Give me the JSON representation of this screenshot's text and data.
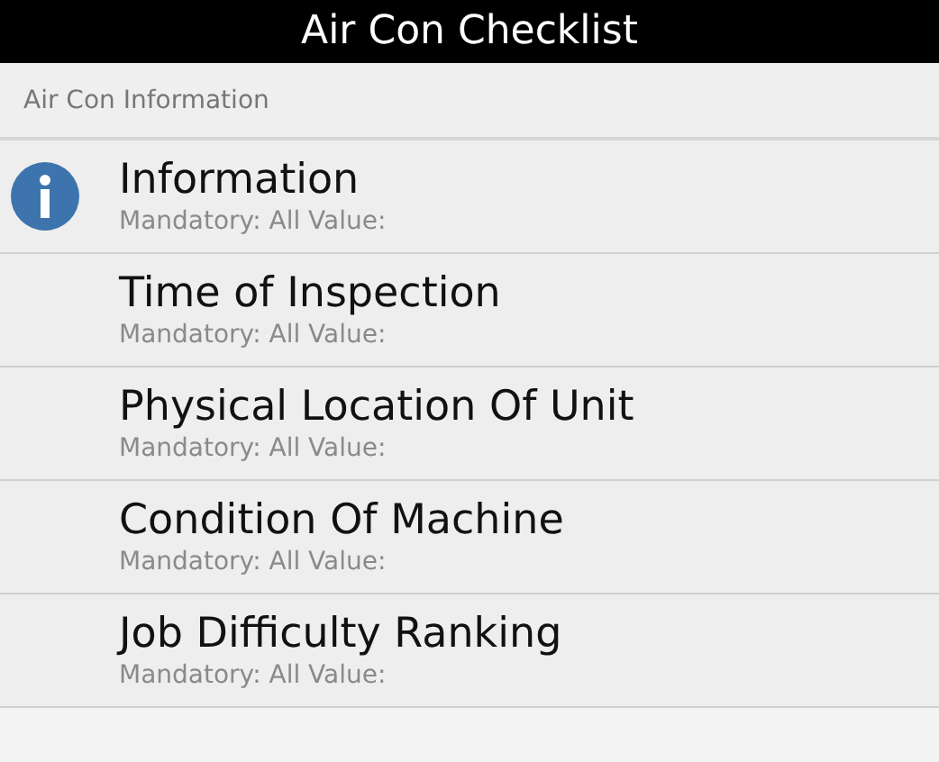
{
  "title": "Air Con Checklist",
  "section": "Air Con Information",
  "items": [
    {
      "kind": "info",
      "title": "Information",
      "subtitle": "Mandatory: All Value:"
    },
    {
      "kind": "plain",
      "title": "Time of Inspection",
      "subtitle": "Mandatory: All Value:"
    },
    {
      "kind": "plain",
      "title": "Physical Location Of Unit",
      "subtitle": "Mandatory: All Value:"
    },
    {
      "kind": "plain",
      "title": "Condition Of Machine",
      "subtitle": "Mandatory: All Value:"
    },
    {
      "kind": "plain",
      "title": "Job Difficulty Ranking",
      "subtitle": "Mandatory: All Value:"
    }
  ]
}
